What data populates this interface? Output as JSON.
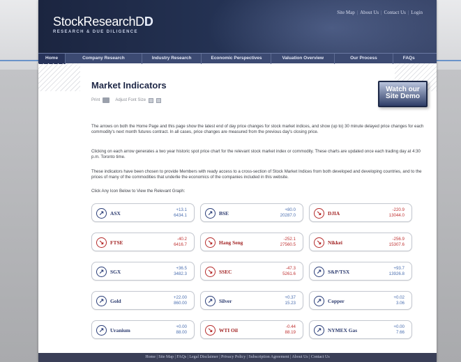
{
  "site": {
    "logo": "StockResearchD",
    "logo_mark": "D",
    "tagline": "RESEARCH & DUE DILIGENCE",
    "toplinks": [
      "Site Map",
      "About Us",
      "Contact Us",
      "Login"
    ]
  },
  "nav": {
    "items": [
      "Home",
      "Company Research",
      "Industry Research",
      "Economic Perspectives",
      "Valuation Overview",
      "Our Process",
      "FAQs"
    ]
  },
  "page": {
    "title": "Market Indicators",
    "print_label": "Print",
    "adjust_font_label": "Adjust Font Size",
    "demo_button": {
      "line1": "Watch our",
      "line2": "Site Demo"
    },
    "paragraphs": [
      "The arrows on both the Home Page and this page show the latest end of day price changes for stock market indices, and show (up to) 30 minute delayed price changes for each commodity's next month futures contract. In all cases, price changes are measured from the previous day's closing price.",
      "Clicking on each arrow generates a two year historic spot price chart for the relevant stock market index or commodity. These charts are updated once each trading day at 4:30 p.m. Toronto time.",
      "These indicators have been chosen to provide Members with ready access to a cross-section of Stock Market Indices from both developed and developing countries, and to the prices of many of the commodities that underlie the economics of the companies included in this website.",
      "Click Any Icon Below to View the Relevant Graph:"
    ]
  },
  "indicators": [
    {
      "name": "ASX",
      "change": "+13.1",
      "value": "6434.1",
      "direction": "up"
    },
    {
      "name": "BSE",
      "change": "+80.0",
      "value": "20287.0",
      "direction": "up"
    },
    {
      "name": "DJIA",
      "change": "-220.9",
      "value": "13044.0",
      "direction": "down"
    },
    {
      "name": "FTSE",
      "change": "-40.2",
      "value": "6416.7",
      "direction": "down"
    },
    {
      "name": "Hang Seng",
      "change": "-252.1",
      "value": "27560.5",
      "direction": "down"
    },
    {
      "name": "Nikkei",
      "change": "-256.9",
      "value": "15307.6",
      "direction": "down"
    },
    {
      "name": "SGX",
      "change": "+36.5",
      "value": "3482.3",
      "direction": "up"
    },
    {
      "name": "SSEC",
      "change": "-47.3",
      "value": "5261.6",
      "direction": "down"
    },
    {
      "name": "S&P/TSX",
      "change": "+93.7",
      "value": "13926.8",
      "direction": "up"
    },
    {
      "name": "Gold",
      "change": "+22.00",
      "value": "860.00",
      "direction": "up"
    },
    {
      "name": "Silver",
      "change": "+0.37",
      "value": "15.23",
      "direction": "up"
    },
    {
      "name": "Copper",
      "change": "+0.02",
      "value": "3.06",
      "direction": "up"
    },
    {
      "name": "Uranium",
      "change": "+0.00",
      "value": "88.00",
      "direction": "up"
    },
    {
      "name": "WTI Oil",
      "change": "-0.44",
      "value": "88.19",
      "direction": "down"
    },
    {
      "name": "NYMEX Gas",
      "change": "+0.00",
      "value": "7.66",
      "direction": "up"
    }
  ],
  "footer": {
    "links": [
      "Home",
      "Site Map",
      "FAQs",
      "Legal Disclaimer",
      "Privacy Policy",
      "Subscription Agreement",
      "About Us",
      "Contact Us"
    ]
  },
  "colors": {
    "header_dark": "#1b2540",
    "nav": "#3c4a72",
    "up": "#2a3d78",
    "down": "#b52a2a",
    "footer": "#3a3f57"
  }
}
